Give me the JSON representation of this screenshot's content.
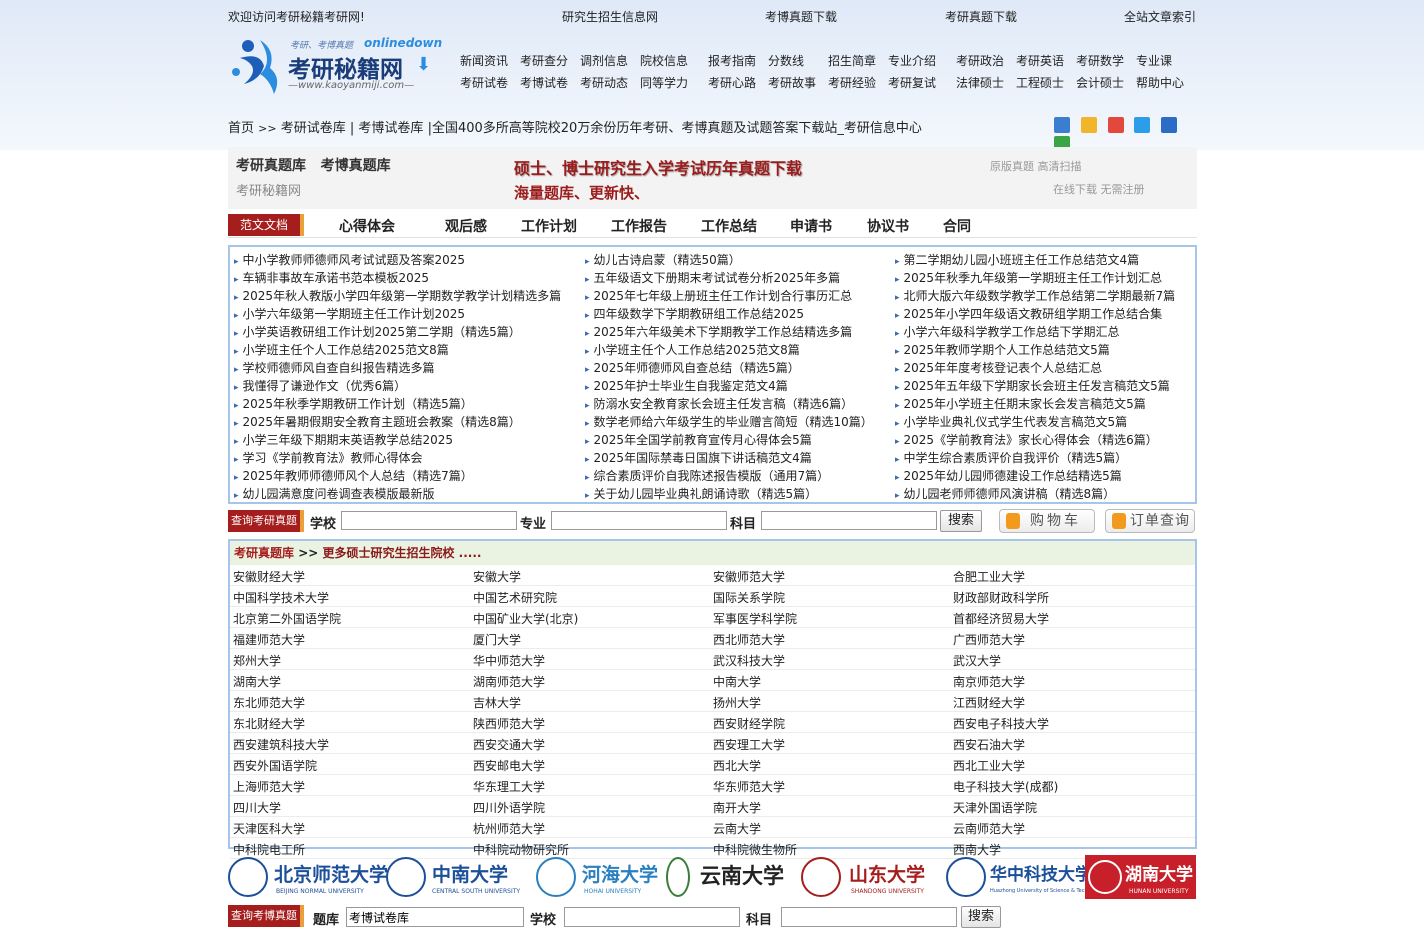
{
  "topbar": {
    "welcome": "欢迎访问考研秘籍考研网!",
    "links": [
      "研究生招生信息网",
      "考博真题下载",
      "考研真题下载",
      "全站文章索引"
    ]
  },
  "logo": {
    "slogan": "考研、考博真题",
    "brand_en": "onlinedown",
    "brand_cn": "考研秘籍网",
    "url_text": "—www.kaoyanmiji.com—"
  },
  "nav": {
    "row1": [
      "新闻资讯",
      "考研查分",
      "调剂信息",
      "院校信息",
      "报考指南",
      "分数线",
      "招生简章",
      "专业介绍",
      "考研政治",
      "考研英语",
      "考研数学",
      "专业课"
    ],
    "row2": [
      "考研试卷",
      "考博试卷",
      "考研动态",
      "同等学力",
      "考研心路",
      "考研故事",
      "考研经验",
      "考研复试",
      "法律硕士",
      "工程硕士",
      "会计硕士",
      "帮助中心"
    ]
  },
  "breadcrumb": {
    "home": "首页",
    "sep": ">>",
    "path1": "考研试卷库",
    "path2": "考博试卷库",
    "desc": "|全国400多所高等院校20万余份历年考研、考博真题及试题答案下载站_考研信息中心"
  },
  "share_icons": [
    "plus-icon",
    "star-icon",
    "weibo-icon",
    "qzone-icon",
    "renren-icon",
    "wechat-icon"
  ],
  "banner": {
    "left1": "考研真题库",
    "left2": "考博真题库",
    "left3": "考研秘籍网",
    "title": "硕士、博士研究生入学考试历年真题下载",
    "sub": "海量题库、更新快、",
    "right1": "原版真题 高清扫描",
    "right2": "在线下载 无需注册"
  },
  "categories": {
    "active": "范文文档",
    "items": [
      "心得体会",
      "观后感",
      "工作计划",
      "工作报告",
      "工作总结",
      "申请书",
      "协议书",
      "合同"
    ]
  },
  "articles": {
    "col1": [
      "中小学教师师德师风考试试题及答案2025",
      "车辆非事故车承诺书范本模板2025",
      "2025年秋人教版小学四年级第一学期数学教学计划精选多篇",
      "小学六年级第一学期班主任工作计划2025",
      "小学英语教研组工作计划2025第二学期（精选5篇）",
      "小学班主任个人工作总结2025范文8篇",
      "学校师德师风自查自纠报告精选多篇",
      "我懂得了谦逊作文（优秀6篇）",
      "2025年秋季学期教研工作计划（精选5篇）",
      "2025年暑期假期安全教育主题班会教案（精选8篇）",
      "小学三年级下期期末英语教学总结2025",
      "学习《学前教育法》教师心得体会",
      "2025年教师师德师风个人总结（精选7篇）",
      "幼儿园满意度问卷调查表模版最新版"
    ],
    "col2": [
      "幼儿古诗启蒙（精选50篇）",
      "五年级语文下册期末考试试卷分析2025年多篇",
      "2025年七年级上册班主任工作计划合行事历汇总",
      "四年级数学下学期教研组工作总结2025",
      "2025年六年级美术下学期教学工作总结精选多篇",
      "小学班主任个人工作总结2025范文8篇",
      "2025年师德师风自查总结（精选5篇）",
      "2025年护士毕业生自我鉴定范文4篇",
      "防溺水安全教育家长会班主任发言稿（精选6篇）",
      "数学老师给六年级学生的毕业赠言简短（精选10篇）",
      "2025年全国学前教育宣传月心得体会5篇",
      "2025年国际禁毒日国旗下讲话稿范文4篇",
      "综合素质评价自我陈述报告模版（通用7篇）",
      "关于幼儿园毕业典礼朗诵诗歌（精选5篇）"
    ],
    "col3": [
      "第二学期幼儿园小班班主任工作总结范文4篇",
      "2025年秋季九年级第一学期班主任工作计划汇总",
      "北师大版六年级数学教学工作总结第二学期最新7篇",
      "2025年小学四年级语文教研组学期工作总结合集",
      "小学六年级科学教学工作总结下学期汇总",
      "2025年教师学期个人工作总结范文5篇",
      "2025年年度考核登记表个人总结汇总",
      "2025年五年级下学期家长会班主任发言稿范文5篇",
      "2025年小学班主任期末家长会发言稿范文5篇",
      "小学毕业典礼仪式学生代表发言稿范文5篇",
      "2025《学前教育法》家长心得体会（精选6篇）",
      "中学生综合素质评价自我评价（精选5篇）",
      "2025年幼儿园师德建设工作总结精选5篇",
      "幼儿园老师师德师风演讲稿（精选8篇）"
    ]
  },
  "search1": {
    "label": "查询考研真题",
    "school_label": "学校",
    "major_label": "专业",
    "subject_label": "科目",
    "school_value": "",
    "major_value": "",
    "subject_value": "",
    "button": "搜索",
    "cart": "购物车",
    "order": "订单查询"
  },
  "schools": {
    "header": "考研真题库",
    "sep": ">>",
    "more": "更多硕士研究生招生院校 .....",
    "rows": [
      [
        "安徽财经大学",
        "安徽大学",
        "安徽师范大学",
        "合肥工业大学"
      ],
      [
        "中国科学技术大学",
        "中国艺术研究院",
        "国际关系学院",
        "财政部财政科学所"
      ],
      [
        "北京第二外国语学院",
        "中国矿业大学(北京)",
        "军事医学科学院",
        "首都经济贸易大学"
      ],
      [
        "福建师范大学",
        "厦门大学",
        "西北师范大学",
        "广西师范大学"
      ],
      [
        "郑州大学",
        "华中师范大学",
        "武汉科技大学",
        "武汉大学"
      ],
      [
        "湖南大学",
        "湖南师范大学",
        "中南大学",
        "南京师范大学"
      ],
      [
        "东北师范大学",
        "吉林大学",
        "扬州大学",
        "江西财经大学"
      ],
      [
        "东北财经大学",
        "陕西师范大学",
        "西安财经学院",
        "西安电子科技大学"
      ],
      [
        "西安建筑科技大学",
        "西安交通大学",
        "西安理工大学",
        "西安石油大学"
      ],
      [
        "西安外国语学院",
        "西安邮电大学",
        "西北大学",
        "西北工业大学"
      ],
      [
        "上海师范大学",
        "华东理工大学",
        "华东师范大学",
        "电子科技大学(成都)"
      ],
      [
        "四川大学",
        "四川外语学院",
        "南开大学",
        "天津外国语学院"
      ],
      [
        "天津医科大学",
        "杭州师范大学",
        "云南大学",
        "云南师范大学"
      ],
      [
        "中科院电工所",
        "中科院动物研究所",
        "中科院微生物所",
        "西南大学"
      ]
    ]
  },
  "uni_logos": [
    {
      "name": "北京师范大学",
      "en": "BEIJING NORMAL UNIVERSITY",
      "color": "#1c4f9a"
    },
    {
      "name": "中南大学",
      "en": "CENTRAL SOUTH UNIVERSITY",
      "color": "#1c4f9a"
    },
    {
      "name": "河海大学",
      "en": "HOHAI UNIVERSITY",
      "color": "#2a7fc0"
    },
    {
      "name": "云南大学",
      "en": "",
      "color": "#222222"
    },
    {
      "name": "山东大学",
      "en": "SHANDONG UNIVERSITY",
      "color": "#a51d1d"
    },
    {
      "name": "华中科技大学",
      "en": "Huazhong University of Science & Technology",
      "color": "#1c4f9a"
    },
    {
      "name": "湖南大学",
      "en": "HUNAN UNIVERSITY",
      "color": "#ffffff"
    }
  ],
  "search2": {
    "label": "查询考博真题",
    "bank_label": "题库",
    "bank_value": "考博试卷库",
    "school_label": "学校",
    "subject_label": "科目",
    "button": "搜索"
  },
  "colors": {
    "accent_red": "#a51d1d",
    "border_blue": "#a7c5e8",
    "orange": "#e9a03a"
  }
}
